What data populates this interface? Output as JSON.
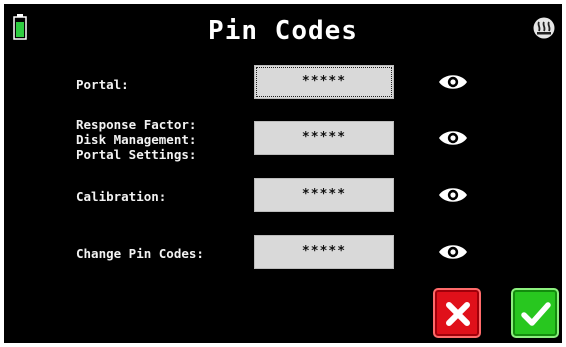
{
  "header": {
    "title": "Pin Codes",
    "battery_icon": "battery-icon",
    "heater_icon": "heater-icon"
  },
  "rows": [
    {
      "label": "Portal:",
      "value": "*****",
      "icon": "eye-icon"
    },
    {
      "label": "Response Factor:\nDisk Management:\nPortal Settings:",
      "value": "*****",
      "icon": "eye-icon"
    },
    {
      "label": "Calibration:",
      "value": "*****",
      "icon": "eye-icon"
    },
    {
      "label": "Change Pin Codes:",
      "value": "*****",
      "icon": "eye-icon"
    }
  ],
  "actions": {
    "cancel_icon": "close-icon",
    "confirm_icon": "checkmark-icon"
  },
  "colors": {
    "background": "#000000",
    "field": "#d9d9d9",
    "cancel": "#e0101a",
    "confirm": "#28c71f",
    "battery": "#2ecc40"
  }
}
